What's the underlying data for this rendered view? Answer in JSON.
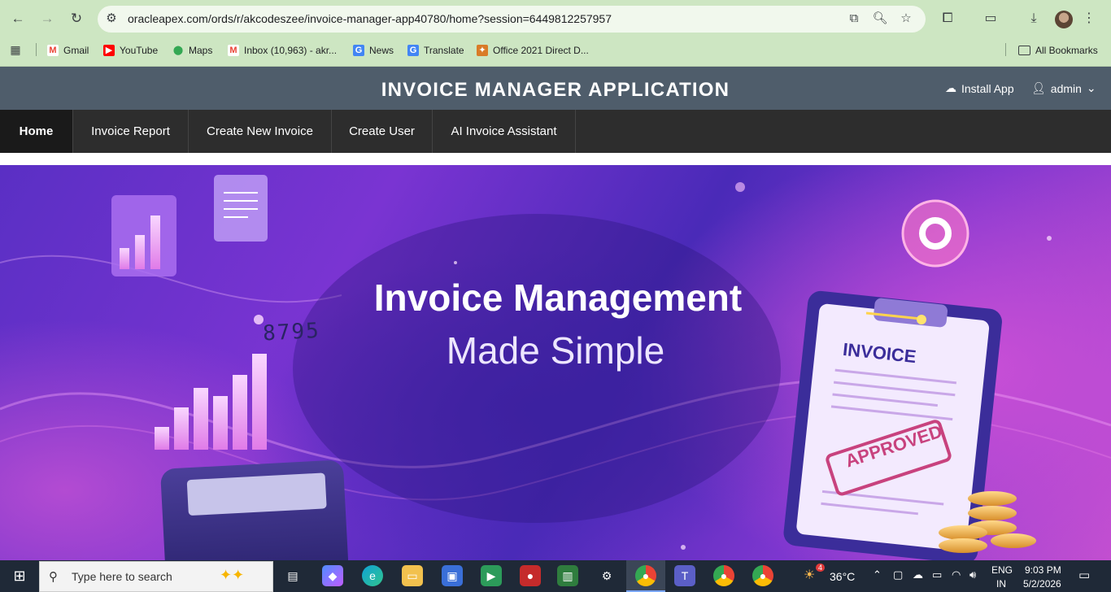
{
  "browser": {
    "url": "oracleapex.com/ords/r/akcodeszee/invoice-manager-app40780/home?session=6449812257957",
    "bookmarks": [
      {
        "label": "Gmail",
        "icon": "gmail-icon",
        "color": "#ea4335"
      },
      {
        "label": "YouTube",
        "icon": "youtube-icon",
        "color": "#ff0000"
      },
      {
        "label": "Maps",
        "icon": "maps-icon",
        "color": "#34a853"
      },
      {
        "label": "Inbox (10,963) - akr...",
        "icon": "gmail-icon",
        "color": "#ea4335"
      },
      {
        "label": "News",
        "icon": "news-icon",
        "color": "#4285f4"
      },
      {
        "label": "Translate",
        "icon": "translate-icon",
        "color": "#4285f4"
      },
      {
        "label": "Office 2021 Direct D...",
        "icon": "office-icon",
        "color": "#d97b27"
      }
    ],
    "all_bookmarks": "All Bookmarks"
  },
  "app": {
    "title": "INVOICE MANAGER APPLICATION",
    "install_app": "Install App",
    "user": "admin",
    "header_color": "#4f5d6b",
    "nav": [
      {
        "label": "Home",
        "active": true
      },
      {
        "label": "Invoice Report",
        "active": false
      },
      {
        "label": "Create New Invoice",
        "active": false
      },
      {
        "label": "Create User",
        "active": false
      },
      {
        "label": "AI Invoice Assistant",
        "active": false
      }
    ]
  },
  "hero": {
    "headline": "Invoice Management",
    "subheadline": "Made Simple",
    "calculator_display": "8795",
    "clipboard_title": "INVOICE",
    "stamp_text": "APPROVED"
  },
  "taskbar": {
    "search_placeholder": "Type here to search",
    "weather": "36°C",
    "weather_badge": "4",
    "language_top": "ENG",
    "language_bottom": "IN",
    "time": "9:03 PM",
    "date": "5/2/2026"
  }
}
